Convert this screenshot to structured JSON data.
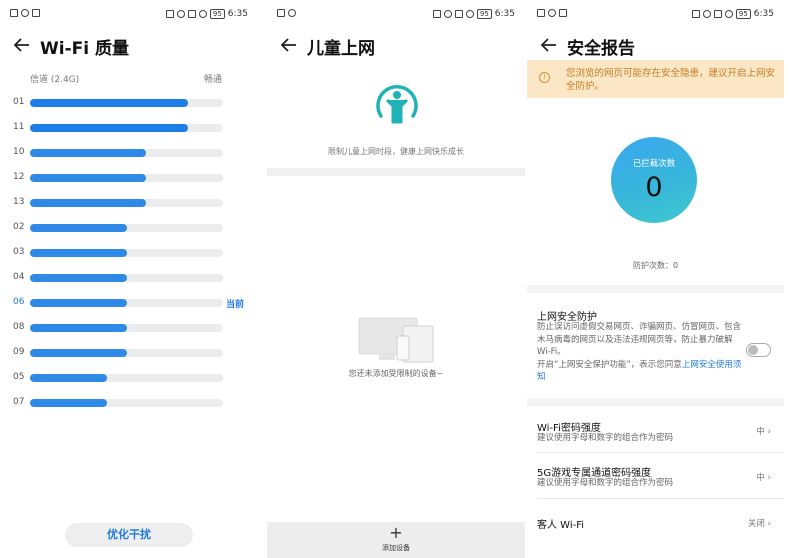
{
  "status_bar": {
    "time": "6:35",
    "battery": "95"
  },
  "screen1": {
    "title": "Wi-Fi 质量",
    "subhead_left": "信道 (2.4G)",
    "subhead_right": "畅通",
    "channels": [
      {
        "name": "01",
        "quality": 0.82,
        "current": false
      },
      {
        "name": "11",
        "quality": 0.82,
        "current": false
      },
      {
        "name": "10",
        "quality": 0.6,
        "current": false
      },
      {
        "name": "12",
        "quality": 0.6,
        "current": false
      },
      {
        "name": "13",
        "quality": 0.6,
        "current": false
      },
      {
        "name": "02",
        "quality": 0.5,
        "current": false
      },
      {
        "name": "03",
        "quality": 0.5,
        "current": false
      },
      {
        "name": "04",
        "quality": 0.5,
        "current": false
      },
      {
        "name": "06",
        "quality": 0.5,
        "current": true
      },
      {
        "name": "08",
        "quality": 0.5,
        "current": false
      },
      {
        "name": "09",
        "quality": 0.5,
        "current": false
      },
      {
        "name": "05",
        "quality": 0.4,
        "current": false
      },
      {
        "name": "07",
        "quality": 0.4,
        "current": false
      }
    ],
    "current_label": "当前",
    "optimize_button": "优化干扰",
    "accent": "#1f7ae0"
  },
  "screen2": {
    "title": "儿童上网",
    "description": "限制儿童上网时段，健康上网快乐成长",
    "empty_text": "您还未添加受限制的设备~",
    "add_button": "添加设备",
    "icon": "child-icon"
  },
  "screen3": {
    "title": "安全报告",
    "warning": "您浏览的网页可能存在安全隐患，建议开启上网安全防护。",
    "blocked_label": "已拦截次数",
    "blocked_count": "0",
    "protect_count": "防护次数：0",
    "protection_title": "上网安全防护",
    "protection_desc": "防止误访问虚假交易网页、诈骗网页、仿冒网页、包含木马病毒的网页以及违法违规网页等，防止暴力破解 Wi-Fi。",
    "protection_notice_prefix": "开启“上网安全保护功能”，表示您同意",
    "protection_notice_link": "上网安全使用须知",
    "protection_enabled": false,
    "wifi_pwd_title": "Wi-Fi密码强度",
    "wifi_pwd_desc": "建议使用字母和数字的组合作为密码",
    "wifi_pwd_value": "中",
    "game_pwd_title": "5G游戏专属通道密码强度",
    "game_pwd_desc": "建议使用字母和数字的组合作为密码",
    "game_pwd_value": "中",
    "guest_title": "客人 Wi-Fi",
    "guest_value": "关闭",
    "warning_color": "#c47d1f"
  }
}
